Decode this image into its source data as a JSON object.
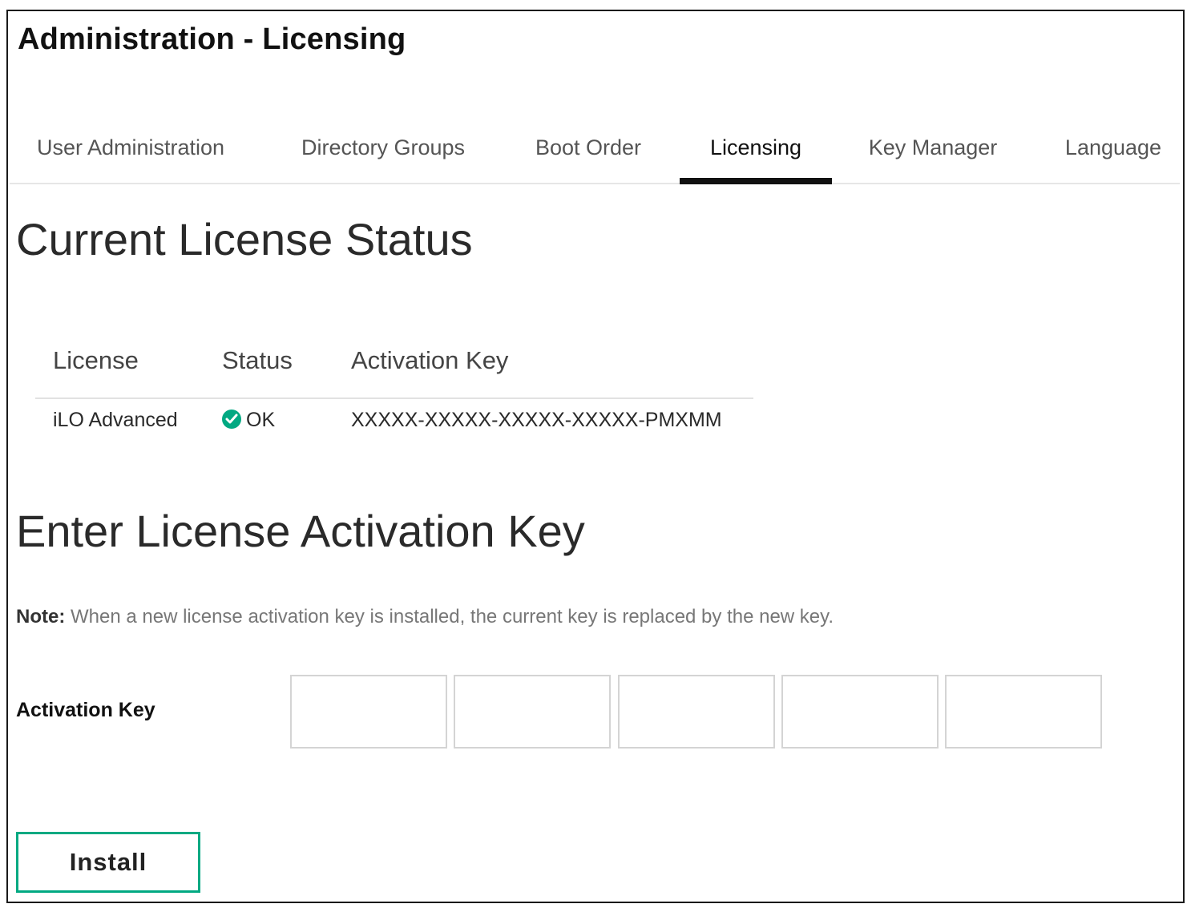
{
  "header": {
    "title": "Administration - Licensing"
  },
  "tabs": [
    {
      "label": "User Administration",
      "active": false
    },
    {
      "label": "Directory Groups",
      "active": false
    },
    {
      "label": "Boot Order",
      "active": false
    },
    {
      "label": "Licensing",
      "active": true
    },
    {
      "label": "Key Manager",
      "active": false
    },
    {
      "label": "Language",
      "active": false
    }
  ],
  "current_status": {
    "heading": "Current License Status",
    "columns": [
      "License",
      "Status",
      "Activation Key"
    ],
    "rows": [
      {
        "license": "iLO Advanced",
        "status": "OK",
        "status_icon": "check-circle-icon",
        "activation_key": "XXXXX-XXXXX-XXXXX-XXXXX-PMXMM"
      }
    ]
  },
  "enter_key": {
    "heading": "Enter License Activation Key",
    "note_label": "Note:",
    "note_text": "When a new license activation key is installed, the current key is replaced by the new key.",
    "field_label": "Activation Key",
    "segments": [
      "",
      "",
      "",
      "",
      ""
    ],
    "install_label": "Install"
  },
  "colors": {
    "accent": "#01a982",
    "tab_active_underline": "#111111"
  }
}
